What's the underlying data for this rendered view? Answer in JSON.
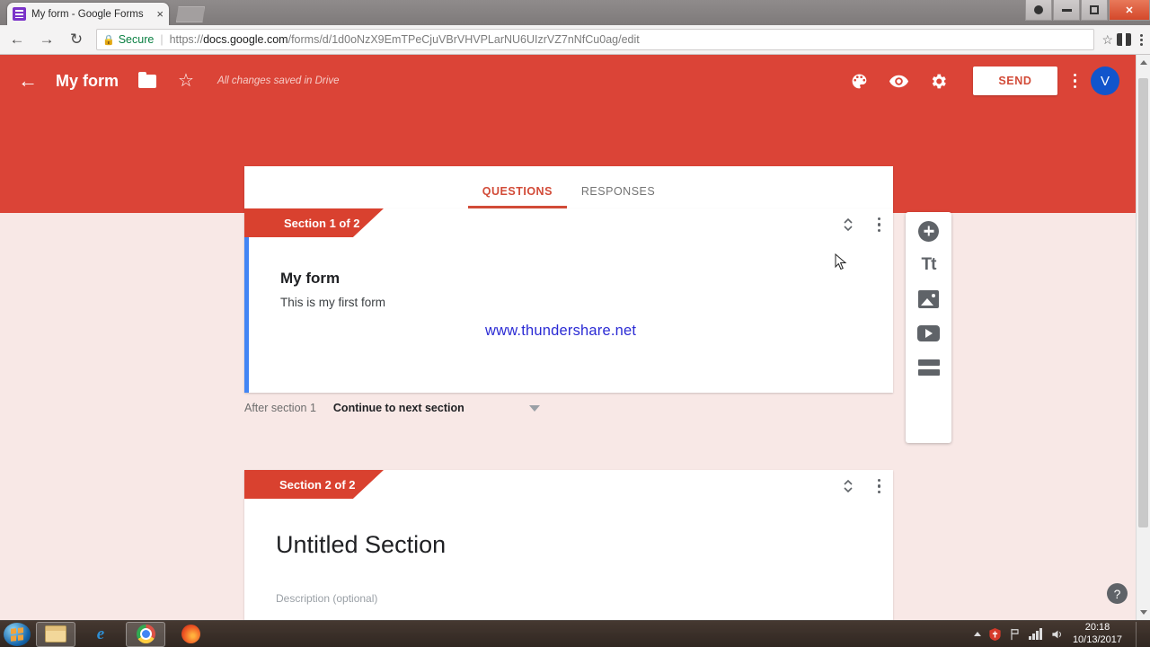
{
  "browser": {
    "tab": {
      "title": "My form - Google Forms",
      "favicon": "forms-icon",
      "close": "×"
    },
    "new_tab_label": "new-tab",
    "window_controls": {
      "user": "user-icon",
      "minimize": "minimize",
      "maximize": "maximize",
      "close": "✕"
    },
    "nav": {
      "back": "←",
      "forward": "→",
      "reload": "↻"
    },
    "address": {
      "lock": "🔒",
      "secure_label": "Secure",
      "separator": "|",
      "url_prefix": "https://",
      "url_domain": "docs.google.com",
      "url_path": "/forms/d/1d0oNzX9EmTPeCjuVBrVHVPLarNU6UIzrVZ7nNfCu0ag/edit",
      "full_url": "https://docs.google.com/forms/d/1d0oNzX9EmTPeCjuVBrVHVPLarNU6UIzrVZ7nNfCu0ag/edit"
    },
    "bookmark_star": "☆",
    "extension": "extension-icon",
    "menu": "chrome-menu"
  },
  "forms": {
    "back_arrow": "←",
    "doc_title": "My form",
    "folder_icon": "move-to-folder-icon",
    "star_icon": "☆",
    "save_status": "All changes saved in Drive",
    "theme_icon": "🎨",
    "preview_icon": "👁",
    "settings_icon": "⚙",
    "send_label": "SEND",
    "more_menu": "more-options",
    "avatar_initial": "V",
    "tabs": [
      {
        "label": "QUESTIONS",
        "active": true
      },
      {
        "label": "RESPONSES",
        "active": false
      }
    ],
    "section1": {
      "banner": "Section 1 of 2",
      "title": "My form",
      "description": "This is my first form",
      "collapse_up": "⌃",
      "collapse_down": "⌄"
    },
    "after_section": {
      "label": "After section 1",
      "value": "Continue to next section"
    },
    "section2": {
      "banner": "Section 2 of 2",
      "title": "Untitled Section",
      "description_placeholder": "Description (optional)",
      "collapse_up": "⌃",
      "collapse_down": "⌄"
    },
    "side_toolbar": [
      {
        "name": "add-question-icon"
      },
      {
        "name": "add-title-icon",
        "label": "Tt"
      },
      {
        "name": "add-image-icon"
      },
      {
        "name": "add-video-icon"
      },
      {
        "name": "add-section-icon"
      }
    ],
    "help_label": "?",
    "watermark": "www.thundershare.net",
    "colors": {
      "header_red": "#db4437",
      "page_background": "#f8e8e6",
      "banner_red": "#d9412f",
      "active_section_accent": "#4285f4",
      "avatar_blue": "#1155cc",
      "watermark_blue": "#2b2bd4"
    }
  },
  "taskbar": {
    "start": "windows-start-orb",
    "items": [
      {
        "name": "file-explorer",
        "pinned": true
      },
      {
        "name": "internet-explorer",
        "pinned": false
      },
      {
        "name": "google-chrome",
        "pinned": true
      },
      {
        "name": "mozilla-firefox",
        "pinned": false
      }
    ],
    "tray": {
      "caret": "show-hidden-icons",
      "antivirus": "antivirus-icon",
      "flag": "action-center-flag",
      "network": "network-icon",
      "volume": "volume-icon"
    },
    "clock_time": "20:18",
    "clock_date": "10/13/2017"
  }
}
